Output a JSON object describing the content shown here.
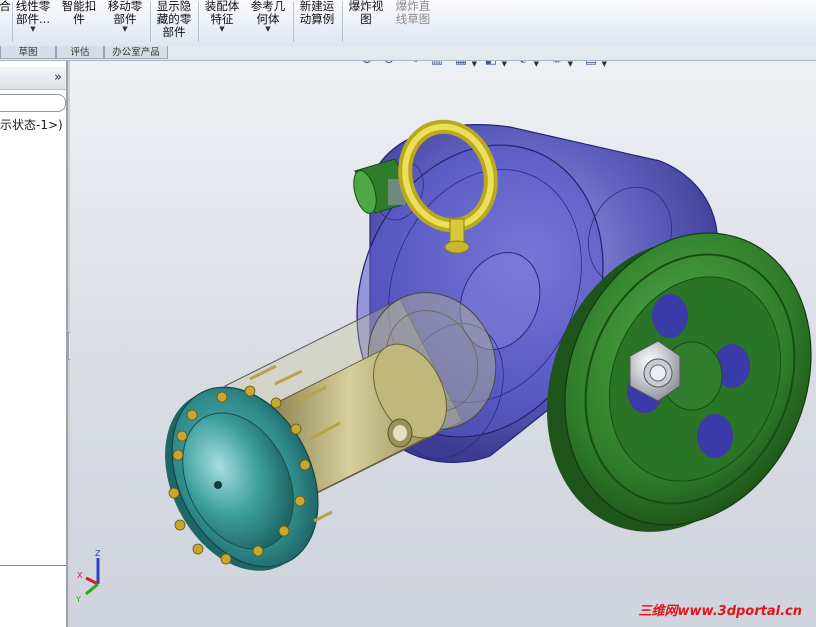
{
  "ribbon": {
    "buttons": [
      {
        "label": "合",
        "has_menu": false,
        "disabled": false
      },
      {
        "label": "线性零\n部件...",
        "has_menu": true,
        "disabled": false
      },
      {
        "label": "智能扣\n件",
        "has_menu": false,
        "disabled": false
      },
      {
        "label": "移动零\n部件",
        "has_menu": true,
        "disabled": false
      },
      {
        "label": "显示隐\n藏的零\n部件",
        "has_menu": false,
        "disabled": false
      },
      {
        "label": "装配体\n特征",
        "has_menu": true,
        "disabled": false
      },
      {
        "label": "参考几\n何体",
        "has_menu": true,
        "disabled": false
      },
      {
        "label": "新建运\n动算例",
        "has_menu": false,
        "disabled": false
      },
      {
        "label": "爆炸视\n图",
        "has_menu": false,
        "disabled": false
      },
      {
        "label": "爆炸直\n线草图",
        "has_menu": false,
        "disabled": true
      }
    ]
  },
  "tabs": [
    "草图",
    "评估",
    "办公室产品"
  ],
  "panel": {
    "collapse_glyph": "»",
    "config_text": "示状态-1>)"
  },
  "view_toolbar": {
    "icons": [
      {
        "name": "zoom-to-fit-icon",
        "glyph": "⊕",
        "has_menu": false
      },
      {
        "name": "zoom-to-area-icon",
        "glyph": "⊙",
        "has_menu": false
      },
      {
        "name": "previous-view-icon",
        "glyph": "✎",
        "has_menu": false
      },
      {
        "name": "section-view-icon",
        "glyph": "▥",
        "has_menu": false
      },
      {
        "name": "view-orientation-icon",
        "glyph": "▦",
        "has_menu": true
      },
      {
        "name": "display-style-icon",
        "glyph": "◧",
        "has_menu": true
      },
      {
        "name": "hide-show-items-icon",
        "glyph": "❦",
        "has_menu": true
      },
      {
        "name": "edit-appearance-icon",
        "glyph": "✺",
        "has_menu": true
      },
      {
        "name": "apply-scene-icon",
        "glyph": "▤",
        "has_menu": true
      }
    ]
  },
  "triad": {
    "x": "X",
    "y": "Y",
    "z": "Z"
  },
  "watermark": "三维网www.3dportal.cn",
  "colors": {
    "housing": "#3a3aa8",
    "pulley": "#2f7d2a",
    "cylinder": "#c9c08a",
    "flange": "#2f8a8a",
    "eyebolt": "#d8c83a",
    "watermark": "#e0161d"
  }
}
